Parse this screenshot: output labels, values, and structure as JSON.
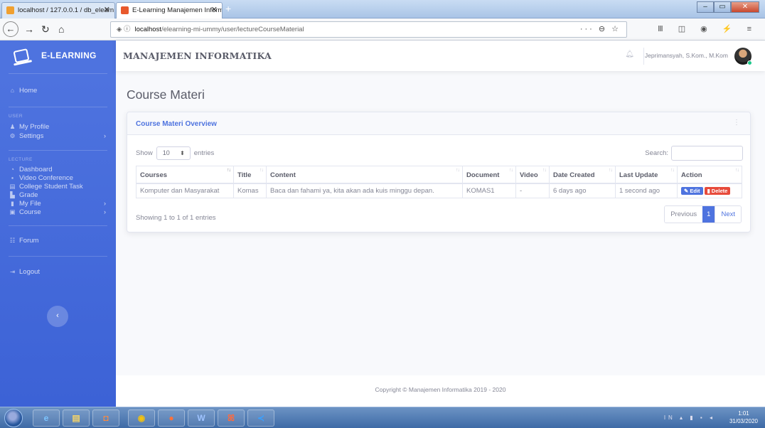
{
  "browser": {
    "tabs": [
      {
        "label": "localhost / 127.0.0.1 / db_elearn"
      },
      {
        "label": "E-Learning Manajemen Inform"
      }
    ],
    "url_host": "localhost",
    "url_path": "/elearning-mi-ummy/user/lectureCourseMaterial",
    "url_actions": "··· ⊖ ☆",
    "tools": "Ⅲ ◫ ◉ ⚡ ≡"
  },
  "sidebar": {
    "brand": "E-LEARNING",
    "home": "Home",
    "section_user": "USER",
    "my_profile": "My Profile",
    "settings": "Settings",
    "section_lecture": "LECTURE",
    "dashboard": "Dashboard",
    "video_conference": "Video Conference",
    "college_student_task": "College Student Task",
    "grade": "Grade",
    "my_file": "My File",
    "course": "Course",
    "forum": "Forum",
    "logout": "Logout"
  },
  "topbar": {
    "title": "MANAJEMEN INFORMATIKA",
    "user_name": "Jeprimansyah, S.Kom., M.Kom"
  },
  "page": {
    "title": "Course Materi",
    "card_title": "Course Materi Overview",
    "show_label": "Show",
    "entries_value": "10",
    "entries_label": "entries",
    "search_label": "Search:",
    "info": "Showing 1 to 1 of 1 entries",
    "pagination": {
      "previous": "Previous",
      "current": "1",
      "next": "Next"
    }
  },
  "table": {
    "headers": [
      "Courses",
      "Title",
      "Content",
      "Document",
      "Video",
      "Date Created",
      "Last Update",
      "Action"
    ],
    "rows": [
      {
        "courses": "Komputer dan Masyarakat",
        "title": "Komas",
        "content": "Baca dan fahami ya, kita akan ada kuis minggu depan.",
        "document": "KOMAS1",
        "video": "-",
        "date_created": "6 days ago",
        "last_update": "1 second ago",
        "edit": "Edit",
        "delete": "Delete"
      }
    ]
  },
  "footer": {
    "copyright": "Copyright © Manajemen Informatika 2019 - 2020"
  },
  "taskbar": {
    "time": "1:01",
    "date": "31/03/2020",
    "lang": "IN"
  },
  "colors": {
    "primary": "#4e73df",
    "danger": "#e74a3b",
    "success": "#1cc88a"
  }
}
